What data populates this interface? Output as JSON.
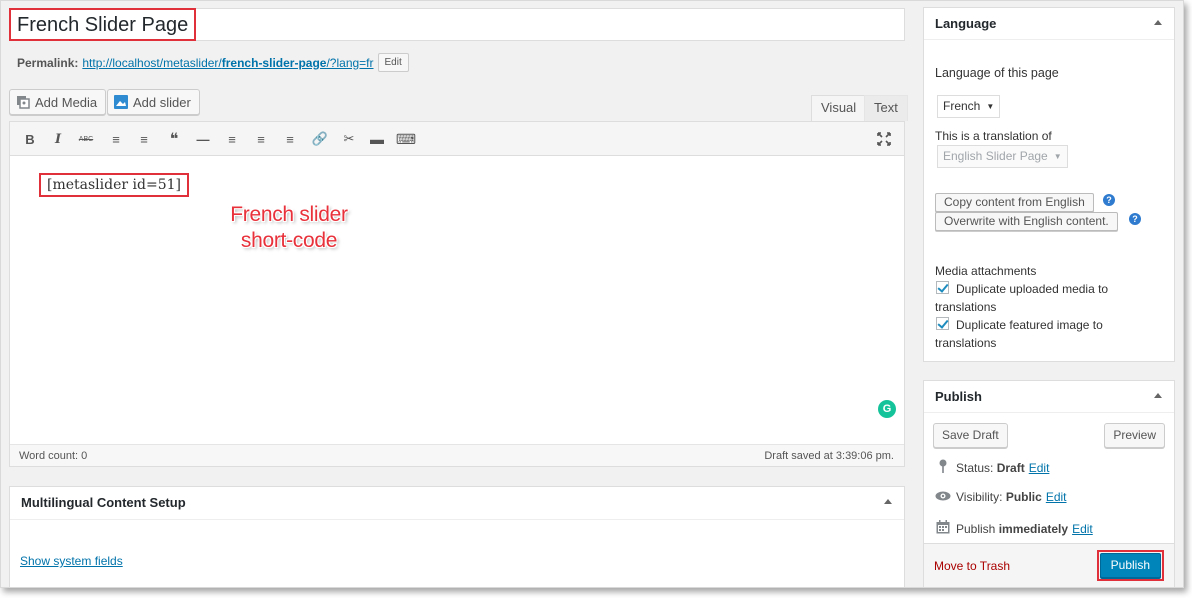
{
  "title": "French Slider Page",
  "permalink": {
    "label": "Permalink:",
    "url_prefix": "http://localhost/metaslider/",
    "slug": "french-slider-page",
    "url_suffix": "/?lang=fr",
    "edit_label": "Edit"
  },
  "media_buttons": {
    "add_media": "Add Media",
    "add_slider": "Add slider"
  },
  "editor_tabs": {
    "visual": "Visual",
    "text": "Text"
  },
  "toolbar": [
    {
      "name": "bold-button",
      "glyph": "B"
    },
    {
      "name": "italic-button",
      "glyph": "I"
    },
    {
      "name": "strikethrough-button",
      "glyph": "ABC"
    },
    {
      "name": "bullet-list-button",
      "glyph": "≡"
    },
    {
      "name": "numbered-list-button",
      "glyph": "≡"
    },
    {
      "name": "blockquote-button",
      "glyph": "❝"
    },
    {
      "name": "horizontal-line-button",
      "glyph": "—"
    },
    {
      "name": "align-left-button",
      "glyph": "≡"
    },
    {
      "name": "align-center-button",
      "glyph": "≡"
    },
    {
      "name": "align-right-button",
      "glyph": "≡"
    },
    {
      "name": "insert-link-button",
      "glyph": "🔗"
    },
    {
      "name": "remove-link-button",
      "glyph": "✂"
    },
    {
      "name": "read-more-button",
      "glyph": "▬"
    },
    {
      "name": "toolbar-toggle-button",
      "glyph": "⌨"
    }
  ],
  "editor": {
    "content": "[metaslider id=51]",
    "annotation_line1": "French slider",
    "annotation_line2": "short-code",
    "grammarly": "G",
    "word_count": "Word count: 0",
    "draft_saved": "Draft saved at 3:39:06 pm."
  },
  "multilingual": {
    "title": "Multilingual Content Setup",
    "show_system_fields": "Show system fields"
  },
  "language_box": {
    "title": "Language",
    "language_of_page_label": "Language of this page",
    "language_selected": "French",
    "translation_of_label": "This is a translation of",
    "translation_selected": "English Slider Page",
    "copy_content_btn": "Copy content from English",
    "overwrite_btn": "Overwrite with English content.",
    "help": "?",
    "media_attachments_label": "Media attachments",
    "dup_media_line1": "Duplicate uploaded media to",
    "dup_media_line2": "translations",
    "dup_featured_line1": "Duplicate featured image to",
    "dup_featured_line2": "translations"
  },
  "publish_box": {
    "title": "Publish",
    "save_draft": "Save Draft",
    "preview": "Preview",
    "status_label": "Status:",
    "status_value": "Draft",
    "visibility_label": "Visibility:",
    "visibility_value": "Public",
    "publish_label": "Publish",
    "publish_value": "immediately",
    "edit": "Edit",
    "move_to_trash": "Move to Trash",
    "publish_btn": "Publish"
  },
  "colors": {
    "accent": "#0085ba",
    "link": "#0073aa",
    "highlight": "#e0303a",
    "trash": "#aa0000"
  }
}
